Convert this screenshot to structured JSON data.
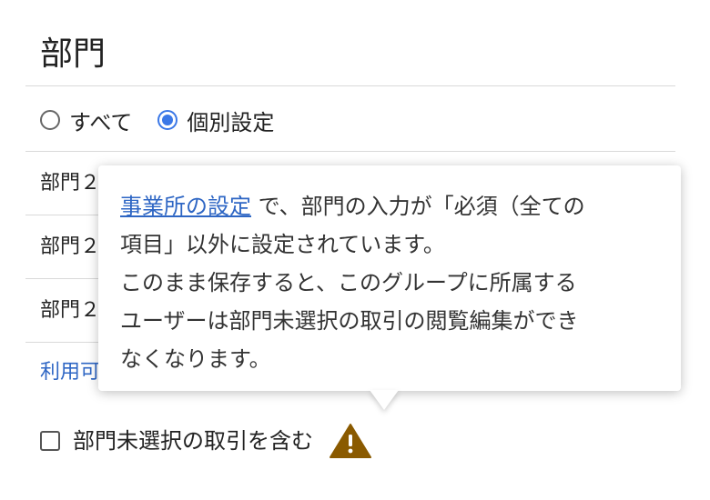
{
  "section": {
    "title": "部門",
    "radio_options": [
      {
        "label": "すべて",
        "selected": false
      },
      {
        "label": "個別設定",
        "selected": true
      }
    ],
    "rows": [
      "部門２",
      "部門２",
      "部門２"
    ],
    "link_text": "利用可",
    "checkbox": {
      "label": "部門未選択の取引を含む",
      "checked": false
    }
  },
  "tooltip": {
    "link_text": "事業所の設定",
    "line1_rest": " で、部門の入力が「必須（全ての",
    "line2": "項目」以外に設定されています。",
    "line3": "このまま保存すると、このグループに所属する",
    "line4": "ユーザーは部門未選択の取引の閲覧編集ができ",
    "line5": "なくなります。"
  },
  "icons": {
    "warning": "warning-triangle-icon"
  },
  "colors": {
    "accent": "#3b78e7",
    "link": "#2e66c4",
    "warning": "#8a5a00"
  }
}
